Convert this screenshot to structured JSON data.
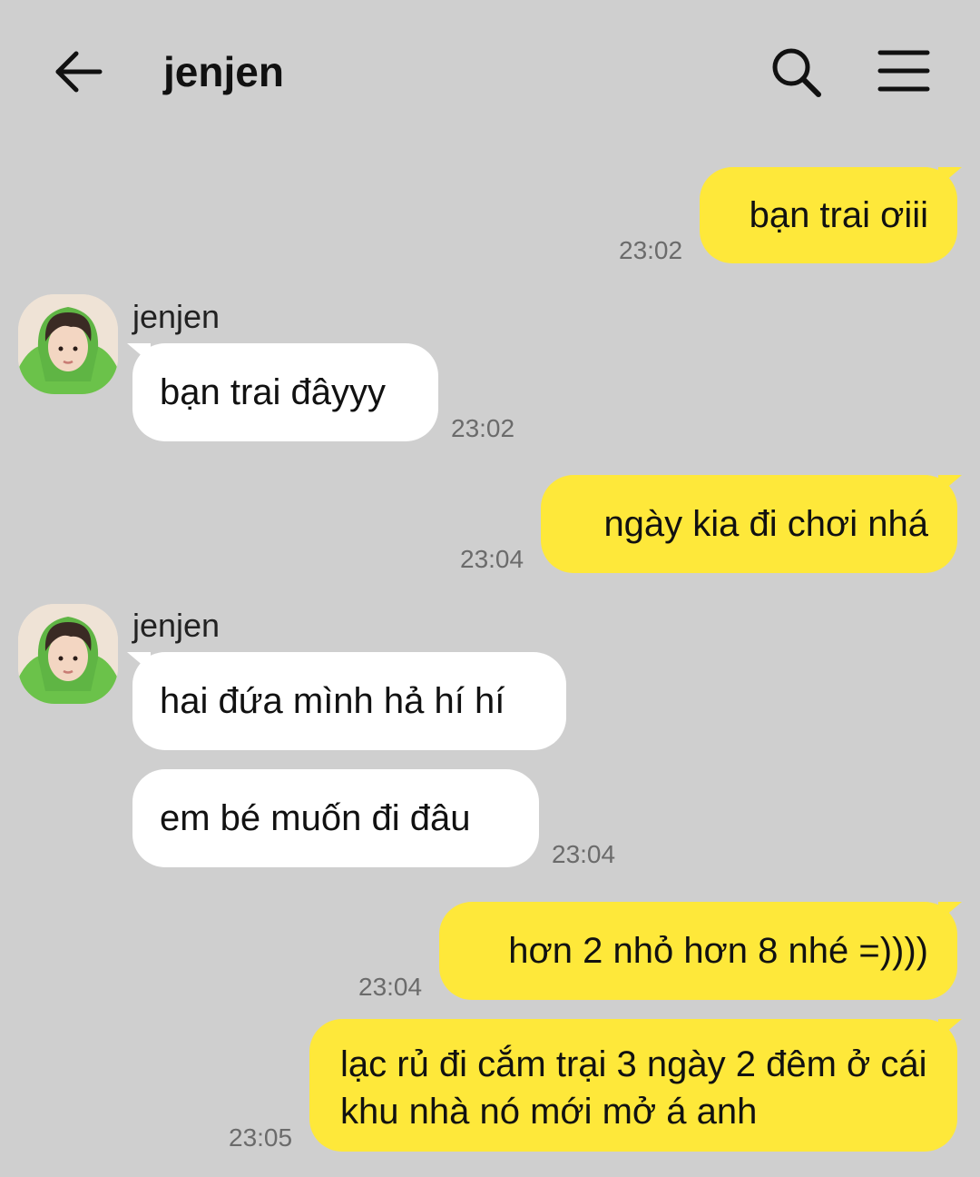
{
  "header": {
    "title": "jenjen",
    "icons": {
      "back": "arrow-left-icon",
      "search": "search-icon",
      "menu": "hamburger-menu-icon"
    }
  },
  "messages": [
    {
      "side": "out",
      "text": "bạn trai ơiii",
      "time": "23:02"
    },
    {
      "side": "in",
      "sender": "jenjen",
      "text": "bạn trai đâyyy",
      "time": "23:02"
    },
    {
      "side": "out",
      "text": "ngày kia đi chơi nhá",
      "time": "23:04"
    },
    {
      "side": "in",
      "sender": "jenjen",
      "text": "hai đứa mình hả hí hí",
      "time": ""
    },
    {
      "side": "in",
      "text": "em bé muốn đi đâu",
      "time": "23:04"
    },
    {
      "side": "out",
      "text": "hơn 2 nhỏ hơn 8 nhé =))))",
      "time": "23:04"
    },
    {
      "side": "out",
      "text": "lạc rủ đi cắm trại 3 ngày 2 đêm ở cái khu nhà nó mới mở á anh",
      "time": "23:05"
    }
  ],
  "colors": {
    "background": "#cfcfcf",
    "outgoing_bubble": "#fee83a",
    "incoming_bubble": "#ffffff",
    "timestamp": "#6b6b6b"
  }
}
